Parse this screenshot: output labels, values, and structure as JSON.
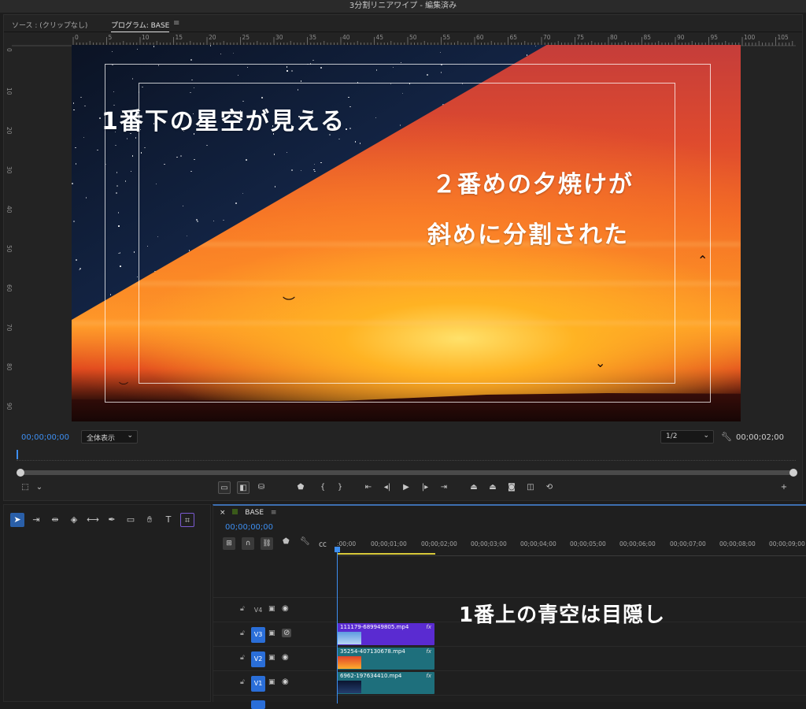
{
  "window": {
    "title": "3分割リニアワイプ - 編集済み"
  },
  "monitor": {
    "source_tab": "ソース : (クリップなし)",
    "program_tab": "プログラム: BASE",
    "menu_icon": "hamburger-icon",
    "ruler_top_labels": [
      "0",
      "5",
      "10",
      "15",
      "20",
      "25",
      "30",
      "35",
      "40",
      "45",
      "50",
      "55",
      "60",
      "65",
      "70",
      "75",
      "80",
      "85",
      "90",
      "95",
      "100",
      "105"
    ],
    "ruler_left_labels": [
      "0",
      "10",
      "20",
      "30",
      "40",
      "50",
      "60",
      "70",
      "80",
      "90"
    ],
    "overlay_text_1": "1番下の星空が見える",
    "overlay_text_2a": "２番めの夕焼けが",
    "overlay_text_2b": "斜めに分割された",
    "timecode_current": "00;00;00;00",
    "fit_value": "全体表示",
    "resolution_value": "1/2",
    "timecode_duration": "00;00;02;00"
  },
  "timeline": {
    "sequence_name": "BASE",
    "timecode": "00;00;00;00",
    "ruler_labels": [
      ":00;00",
      "00;00;01;00",
      "00;00;02;00",
      "00;00;03;00",
      "00;00;04;00",
      "00;00;05;00",
      "00;00;06;00",
      "00;00;07;00",
      "00;00;08;00",
      "00;00;09;00"
    ],
    "tracks": [
      {
        "name": "V4"
      },
      {
        "name": "V3",
        "clip": "111179-689949805.mp4"
      },
      {
        "name": "V2",
        "clip": "35254-407130678.mp4"
      },
      {
        "name": "V1",
        "clip": "6962-197634410.mp4"
      }
    ],
    "fx_label": "fx",
    "note": "1番上の青空は目隠し"
  },
  "colors": {
    "accent": "#3d8ef0",
    "clip_v3": "#5a2bd1",
    "clip_v2": "#1e6f7c",
    "clip_v1": "#1e6f7c",
    "work_area": "#d8c93a"
  }
}
